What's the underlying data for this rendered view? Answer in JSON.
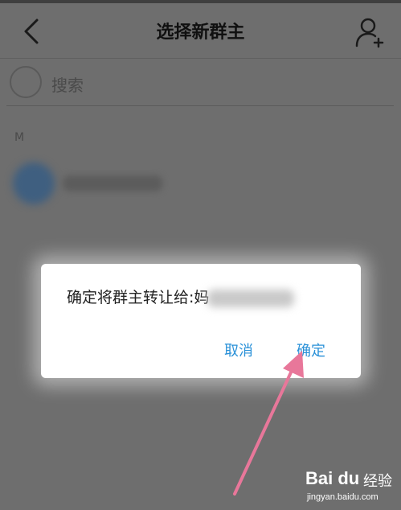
{
  "header": {
    "title": "选择新群主",
    "back_icon": "chevron-left-icon",
    "add_icon": "person-add-icon"
  },
  "search": {
    "placeholder": "搜索"
  },
  "contacts": {
    "section_letter": "M"
  },
  "dialog": {
    "message_prefix": "确定将群主转让给:妈",
    "cancel_label": "取消",
    "confirm_label": "确定"
  },
  "watermark": {
    "brand": "Bai du",
    "label": "经验",
    "url": "jingyan.baidu.com"
  },
  "colors": {
    "overlay": "#6e6e6e",
    "dialog_bg": "#ffffff",
    "button_text": "#2a91d8",
    "arrow": "#e8779a"
  }
}
